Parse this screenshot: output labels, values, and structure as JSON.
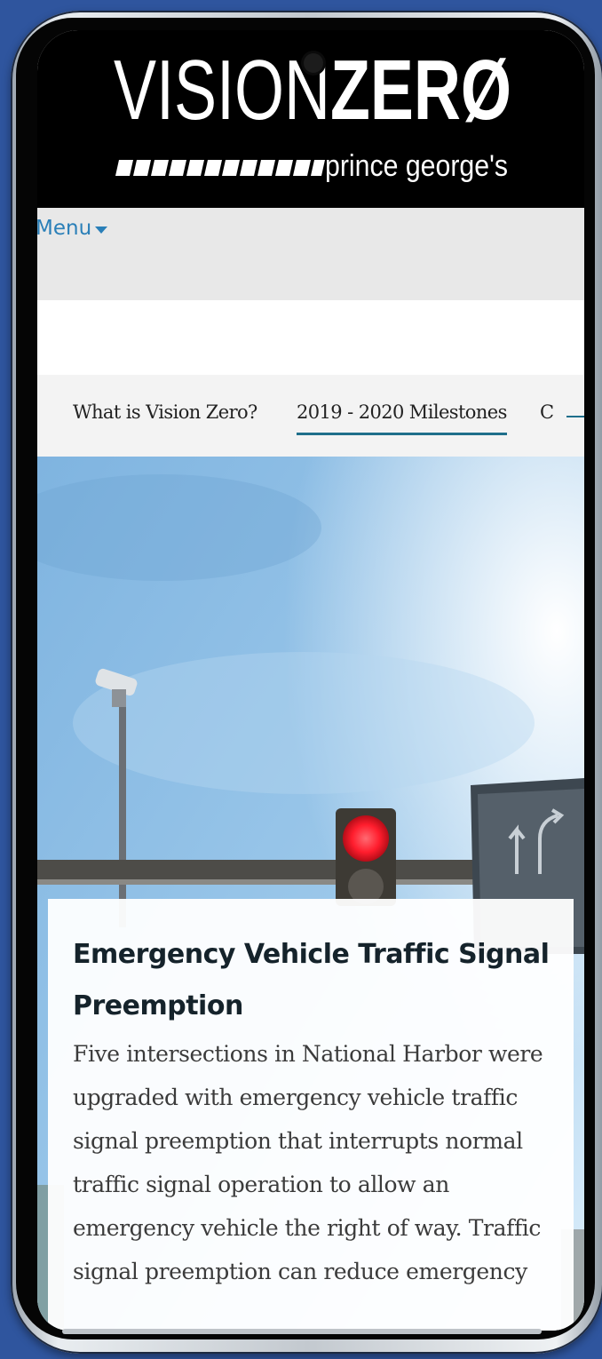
{
  "logo": {
    "vision": "VISION",
    "zero": "ZERØ",
    "subtitle": "prince george's"
  },
  "menu": {
    "label": "Menu"
  },
  "tabs": [
    {
      "label": "What is Vision Zero?",
      "active": false
    },
    {
      "label": "2019 - 2020 Milestones",
      "active": true
    },
    {
      "label": "C",
      "active": false
    }
  ],
  "card": {
    "title": "Emergency Vehicle Traffic Signal Preemption",
    "body": "Five intersections in National Harbor were upgraded with emergency vehicle traffic signal preemption that interrupts normal traffic signal operation to allow an emergency vehicle the right of way. Traffic signal preemption can reduce emergency"
  },
  "colors": {
    "background": "#2f559e",
    "menu_link": "#2a7fb8",
    "tab_underline": "#1f6f8b",
    "signal_red": "#ff1d2d"
  }
}
